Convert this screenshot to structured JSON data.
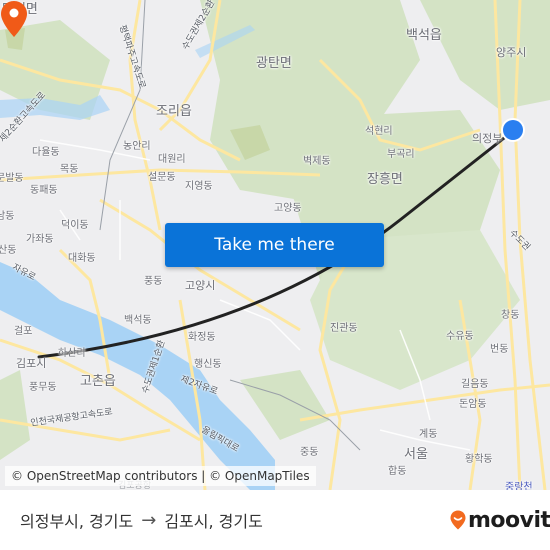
{
  "map": {
    "button_label": "Take me there",
    "attribution": "© OpenStreetMap contributors | © OpenMapTiles",
    "colors": {
      "button": "#0a73d8",
      "origin_marker": "#2a7ff0",
      "destination_marker": "#f05a18",
      "route_line": "#222222",
      "water": "#a9d3f5",
      "forest": "#cfe0bf",
      "road": "#fde9a3"
    },
    "labels": {
      "tanhyeon": "탄현면",
      "baekseok_eup": "백석읍",
      "yangju": "양주시",
      "gwangtan": "광탄면",
      "jori": "조리읍",
      "nongan": "농안리",
      "daewon": "대원리",
      "seolmun": "설문동",
      "jiyeong": "지영동",
      "dayul": "다율동",
      "mokdong": "목동",
      "munbal": "문발동",
      "dongpae": "동패동",
      "seokhyeon": "석현리",
      "bugok": "부곡리",
      "byeokje": "벽제동",
      "uijeongbu": "의정부",
      "janghung": "장흥면",
      "goyang_dong": "고양동",
      "namdong": "남동",
      "deogi": "덕이동",
      "gajwa": "가좌동",
      "sandong": "산동",
      "daehwa": "대화동",
      "pungdong": "풍동",
      "goyang_si": "고양시",
      "baekseok_dong": "백석동",
      "hwajeong": "화정동",
      "haengsin": "행신동",
      "geolpo": "걸포",
      "gimpo": "김포시",
      "hasan": "하산리",
      "gochon": "고촌읍",
      "pungmu": "풍무동",
      "jingwan": "진관동",
      "suyu": "수유동",
      "changdong": "창동",
      "beondong": "번동",
      "gireum": "길음동",
      "donam": "돈암동",
      "gyedong": "계동",
      "seoul": "서울",
      "hwanghak": "황학동",
      "jungdong": "중동",
      "hapdong": "합동",
      "jungnang": "중랑천"
    },
    "roads": {
      "jayuro": "자유로",
      "jayuro2": "제2자유로",
      "second_ring": "제2순환고속도로",
      "pyeongtaek_paju": "평택파주고속도로",
      "capital_ring2": "수도권제2순환",
      "capital_ring1": "수도권제1순환",
      "capital_ring_e": "수도권",
      "incheon_airport": "인천국제공항고속도로",
      "olympic": "올림픽대로",
      "gimpo_airport": "김포공항"
    }
  },
  "footer": {
    "origin": "의정부시, 경기도",
    "arrow": "→",
    "destination": "김포시, 경기도",
    "brand": "moovit",
    "brand_color": "#f26a1f"
  }
}
